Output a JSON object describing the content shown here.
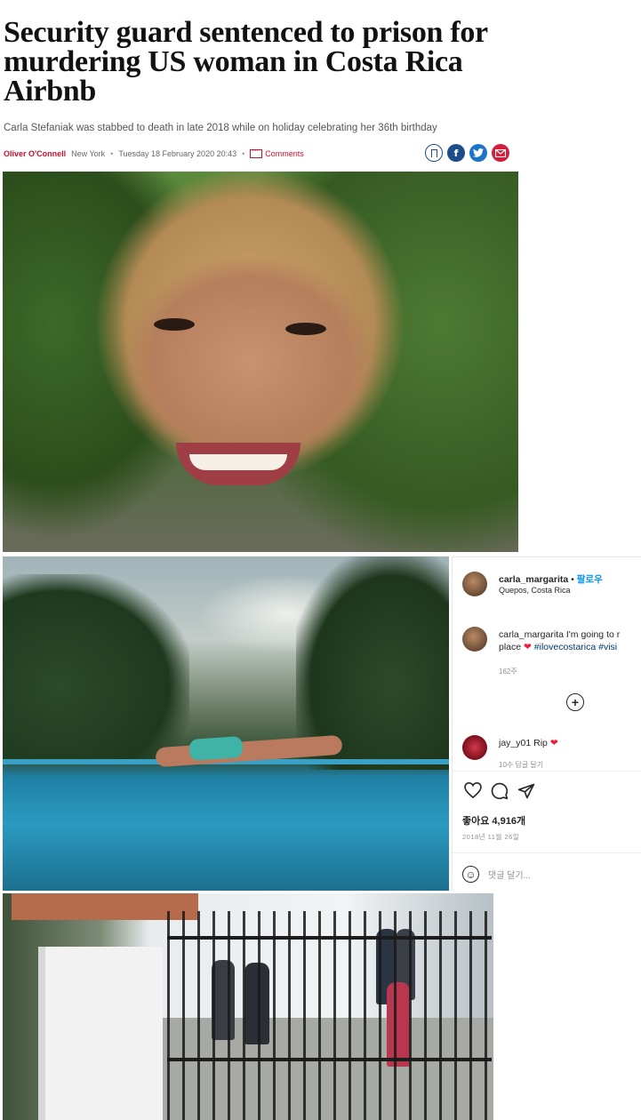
{
  "article": {
    "headline": "Security guard sentenced to prison for murdering US woman in Costa Rica Airbnb",
    "subheadline": "Carla Stefaniak was stabbed to death in late 2018 while on holiday celebrating her 36th birthday",
    "author": "Oliver O'Connell",
    "location": "New York",
    "datetime": "Tuesday 18 February 2020 20:43",
    "comments_label": "Comments",
    "share_icons": [
      "bookmark-icon",
      "facebook-icon",
      "twitter-icon",
      "email-icon"
    ],
    "accent_color": "#c8102e"
  },
  "instagram": {
    "username": "carla_margarita",
    "follow_label": "팔로우",
    "separator": "•",
    "location": "Quepos, Costa Rica",
    "caption_user": "carla_margarita",
    "caption_text": "I'm going to r",
    "caption_line2": "place",
    "caption_heart": "❤",
    "caption_tags": "#ilovecostarica #visi",
    "caption_age": "162주",
    "comment_user": "jay_y01",
    "comment_text": "Rip",
    "comment_heart": "❤",
    "comment_meta": "10수   답글 달기",
    "likes": "좋아요 4,916개",
    "date": "2018년 11월 26일",
    "add_comment_placeholder": "댓글 달기...",
    "action_icons": [
      "heart-icon",
      "comment-icon",
      "share-icon"
    ],
    "follow_color": "#0095f6"
  }
}
